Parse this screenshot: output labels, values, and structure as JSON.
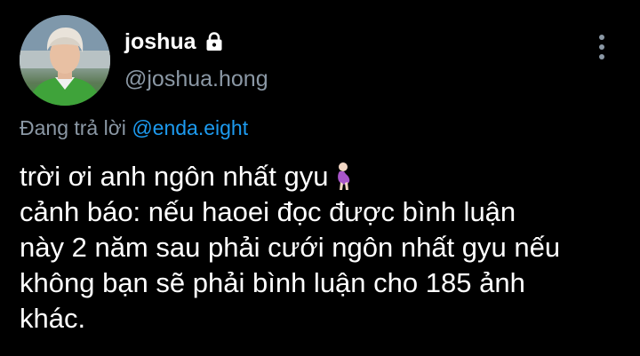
{
  "author": {
    "display_name": "joshua",
    "username": "@joshua.hong",
    "protected_icon": "lock-icon",
    "avatar_icon": "profile-photo"
  },
  "menu": {
    "icon": "more-vertical-icon"
  },
  "reply": {
    "prefix": "Đang trả lời",
    "handle": "@enda.eight"
  },
  "tweet": {
    "lines": [
      "trời ơi anh ngôn nhất gyu",
      "cảnh báo: nếu haoei đọc được bình luận",
      "này 2 năm sau phải cưới ngôn nhất gyu nếu",
      "không bạn sẽ phải bình luận cho 185 ảnh",
      "khác."
    ],
    "emoji": "pregnant-woman-emoji"
  },
  "colors": {
    "background": "#000000",
    "text": "#ffffff",
    "secondary": "#8b98a5",
    "link": "#1d9bf0"
  }
}
